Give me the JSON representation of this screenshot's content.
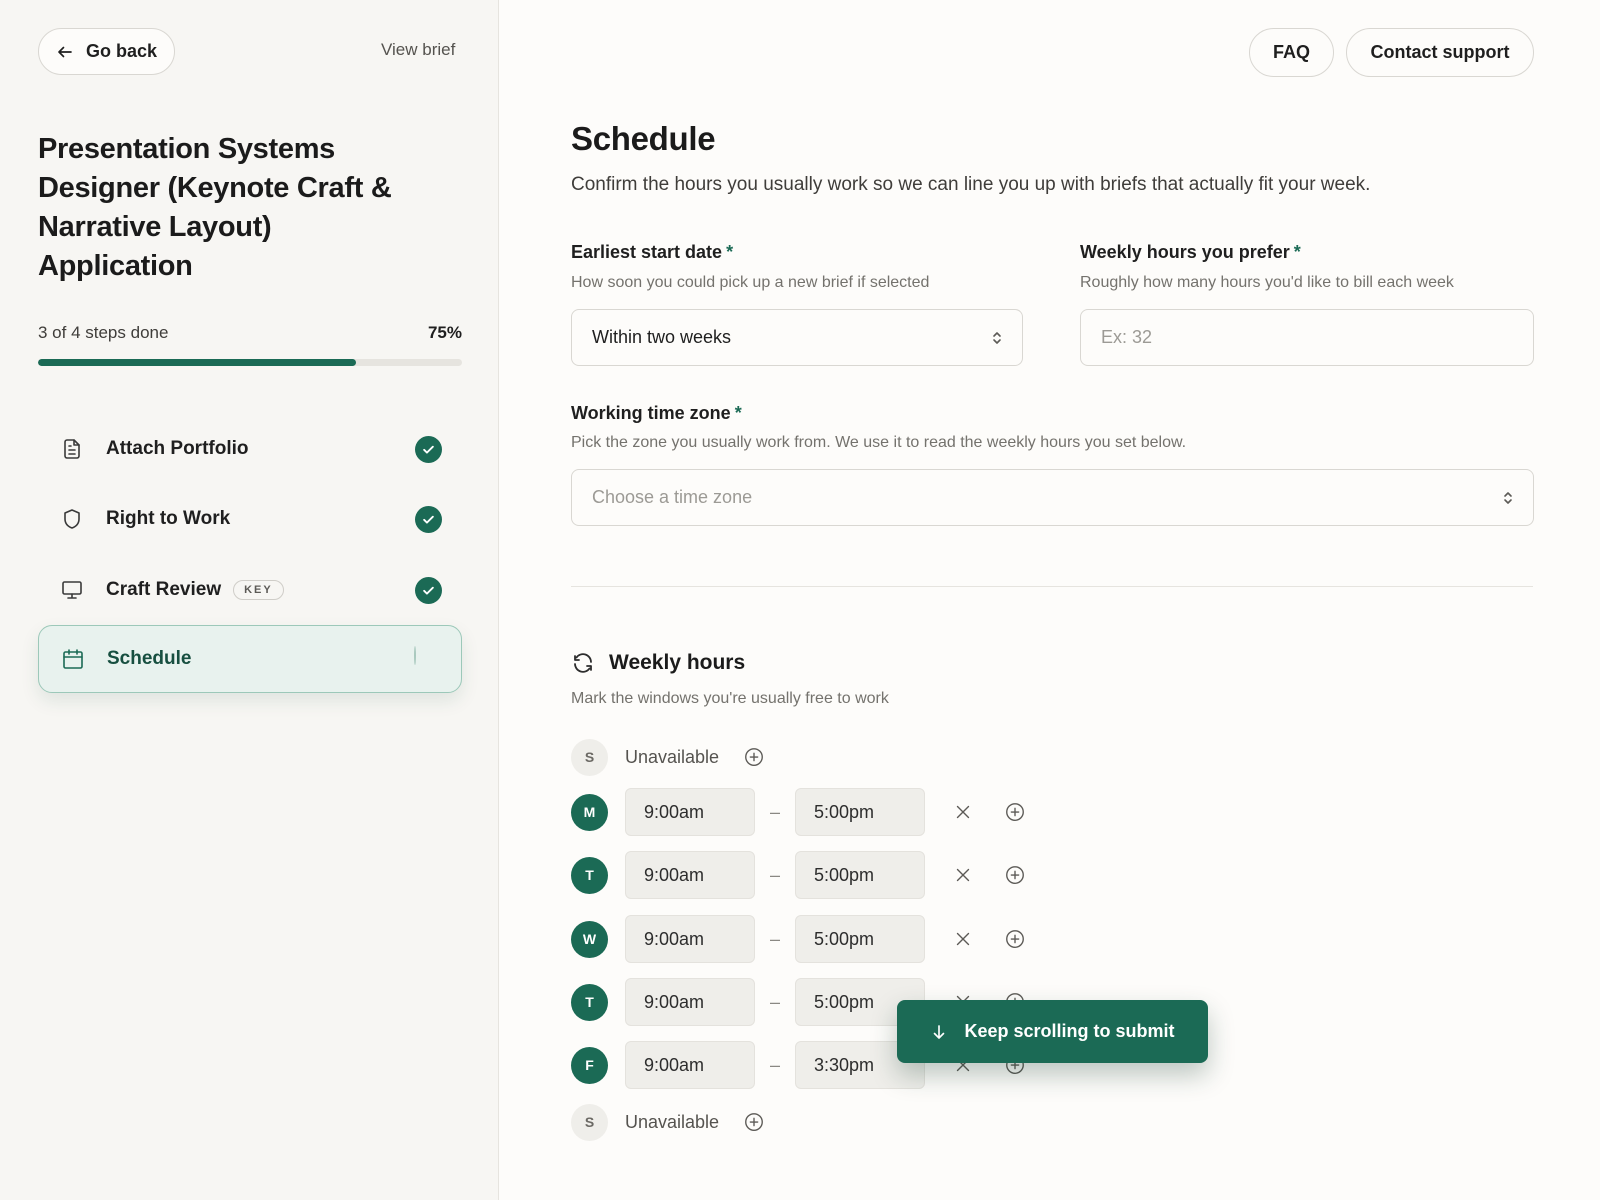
{
  "sidebar": {
    "go_back": "Go back",
    "view_brief": "View brief",
    "app_title": "Presentation Systems Designer (Keynote Craft & Narrative Layout) Application",
    "progress": {
      "label": "3 of 4 steps done",
      "percent": "75%",
      "fraction": 0.75
    },
    "steps": [
      {
        "label": "Attach Portfolio",
        "icon": "document-icon",
        "status": "done",
        "badge": ""
      },
      {
        "label": "Right to Work",
        "icon": "shield-icon",
        "status": "done",
        "badge": ""
      },
      {
        "label": "Craft Review",
        "icon": "monitor-icon",
        "status": "done",
        "badge": "KEY"
      },
      {
        "label": "Schedule",
        "icon": "calendar-icon",
        "status": "current",
        "badge": ""
      }
    ]
  },
  "header": {
    "faq": "FAQ",
    "contact_support": "Contact support"
  },
  "main": {
    "title": "Schedule",
    "subtitle": "Confirm the hours you usually work so we can line you up with briefs that actually fit your week.",
    "start_date": {
      "label": "Earliest start date",
      "required_mark": "*",
      "help": "How soon you could pick up a new brief if selected",
      "value": "Within two weeks"
    },
    "weekly_hours_pref": {
      "label": "Weekly hours you prefer",
      "required_mark": "*",
      "help": "Roughly how many hours you'd like to bill each week",
      "placeholder": "Ex: 32"
    },
    "time_zone": {
      "label": "Working time zone",
      "required_mark": "*",
      "help": "Pick the zone you usually work from. We use it to read the weekly hours you set below.",
      "placeholder": "Choose a time zone"
    },
    "weekly_hours": {
      "title": "Weekly hours",
      "subtitle": "Mark the windows you're usually free to work",
      "separator": "–",
      "days": [
        {
          "letter": "S",
          "available": false,
          "status_text": "Unavailable"
        },
        {
          "letter": "M",
          "available": true,
          "start": "9:00am",
          "end": "5:00pm"
        },
        {
          "letter": "T",
          "available": true,
          "start": "9:00am",
          "end": "5:00pm"
        },
        {
          "letter": "W",
          "available": true,
          "start": "9:00am",
          "end": "5:00pm"
        },
        {
          "letter": "T",
          "available": true,
          "start": "9:00am",
          "end": "5:00pm"
        },
        {
          "letter": "F",
          "available": true,
          "start": "9:00am",
          "end": "3:30pm"
        },
        {
          "letter": "S",
          "available": false,
          "status_text": "Unavailable"
        }
      ]
    }
  },
  "toast": {
    "label": "Keep scrolling to submit",
    "icon": "arrow-down-icon"
  },
  "colors": {
    "accent": "#1b6a55",
    "accent_light": "#e8f2ee",
    "background": "#fdfcfa",
    "sidebar_bg": "#f7f6f3"
  }
}
